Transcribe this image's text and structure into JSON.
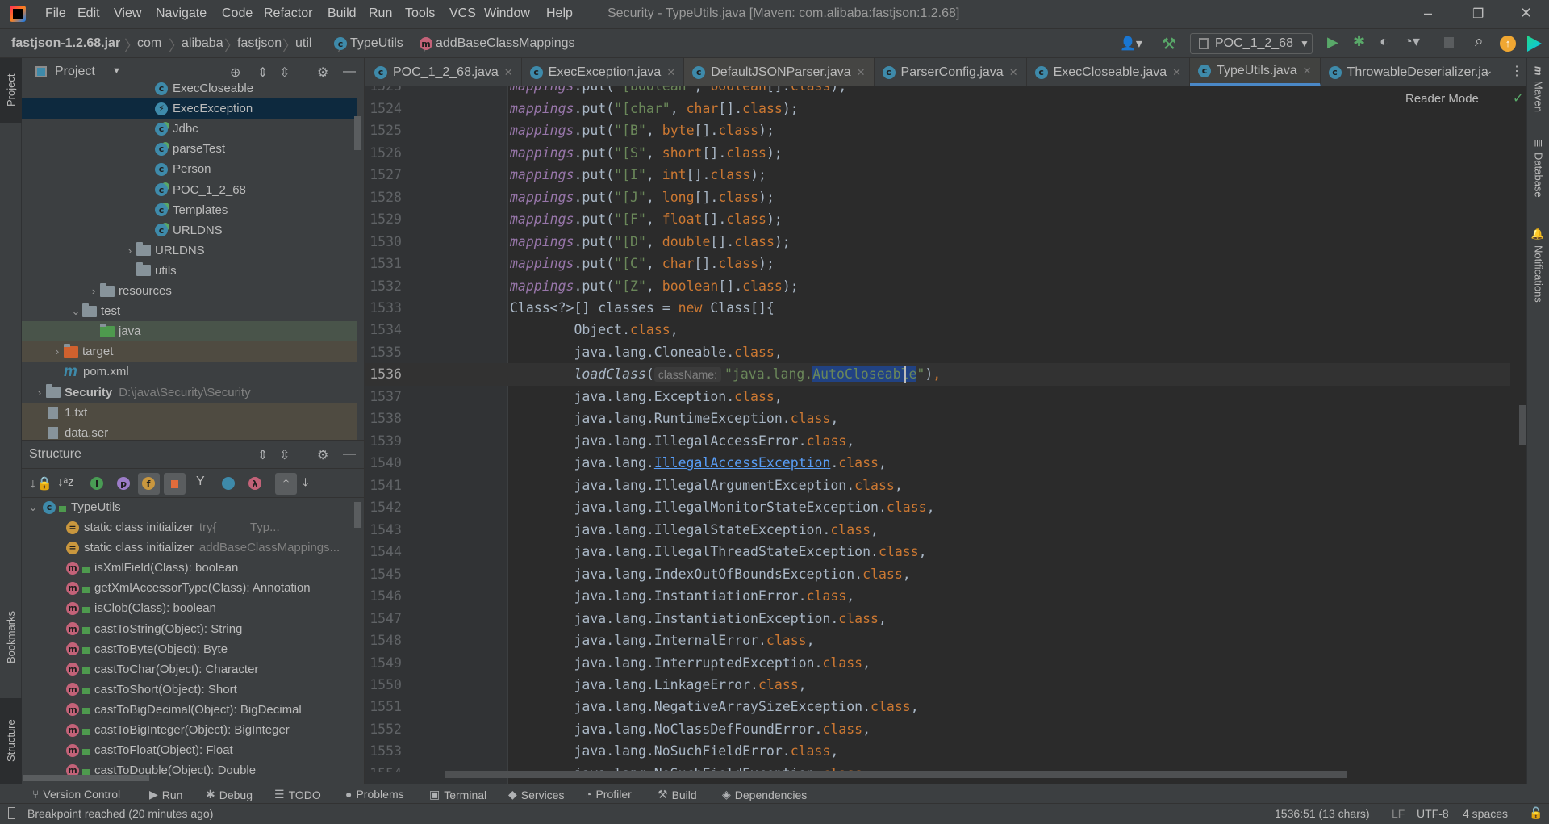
{
  "window": {
    "title": "Security - TypeUtils.java [Maven: com.alibaba:fastjson:1.2.68]",
    "menu": [
      "File",
      "Edit",
      "View",
      "Navigate",
      "Code",
      "Refactor",
      "Build",
      "Run",
      "Tools",
      "VCS",
      "Window",
      "Help"
    ]
  },
  "breadcrumb": [
    "fastjson-1.2.68.jar",
    "com",
    "alibaba",
    "fastjson",
    "util",
    "TypeUtils",
    "addBaseClassMappings"
  ],
  "run_config": "POC_1_2_68",
  "left_strip": [
    "Project",
    "Bookmarks",
    "Structure"
  ],
  "right_strip": [
    "Maven",
    "Database",
    "Notifications"
  ],
  "project": {
    "title": "Project",
    "items": [
      {
        "label": "ExecCloseable",
        "depth": 7,
        "icon": "class-icon"
      },
      {
        "label": "ExecException",
        "depth": 7,
        "icon": "exception-class-icon",
        "selected": true
      },
      {
        "label": "Jdbc",
        "depth": 7,
        "icon": "runnable-class-icon"
      },
      {
        "label": "parseTest",
        "depth": 7,
        "icon": "runnable-class-icon"
      },
      {
        "label": "Person",
        "depth": 7,
        "icon": "class-icon"
      },
      {
        "label": "POC_1_2_68",
        "depth": 7,
        "icon": "runnable-class-icon"
      },
      {
        "label": "Templates",
        "depth": 7,
        "icon": "runnable-class-icon"
      },
      {
        "label": "URLDNS",
        "depth": 7,
        "icon": "runnable-class-icon"
      },
      {
        "label": "URLDNS",
        "depth": 6,
        "icon": "package-icon",
        "chevron": "right"
      },
      {
        "label": "utils",
        "depth": 6,
        "icon": "package-icon"
      },
      {
        "label": "resources",
        "depth": 4,
        "icon": "resources-folder-icon",
        "chevron": "right"
      },
      {
        "label": "test",
        "depth": 3,
        "icon": "folder-icon",
        "chevron": "down"
      },
      {
        "label": "java",
        "depth": 4,
        "icon": "test-folder-icon",
        "highlight": "#49544A"
      },
      {
        "label": "target",
        "depth": 2,
        "icon": "excluded-folder-icon",
        "chevron": "right",
        "highlight": "#4F4B41"
      },
      {
        "label": "pom.xml",
        "depth": 2,
        "icon": "maven-icon"
      },
      {
        "label": "Security",
        "depth": 1,
        "icon": "module-icon",
        "chevron": "right",
        "bold": true,
        "extra": "D:\\java\\Security\\Security"
      },
      {
        "label": "1.txt",
        "depth": 1,
        "icon": "text-file-icon",
        "highlight": "#4F4B41"
      },
      {
        "label": "data.ser",
        "depth": 1,
        "icon": "file-icon",
        "highlight": "#4F4B41"
      }
    ]
  },
  "structure": {
    "title": "Structure",
    "root": "TypeUtils",
    "items": [
      {
        "label": "static class initializer",
        "extra": "try{          Typ...",
        "kind": "static"
      },
      {
        "label": "static class initializer",
        "extra": "addBaseClassMappings...",
        "kind": "static"
      },
      {
        "label": "isXmlField(Class): boolean",
        "kind": "method"
      },
      {
        "label": "getXmlAccessorType(Class): Annotation",
        "kind": "method"
      },
      {
        "label": "isClob(Class): boolean",
        "kind": "method"
      },
      {
        "label": "castToString(Object): String",
        "kind": "method"
      },
      {
        "label": "castToByte(Object): Byte",
        "kind": "method"
      },
      {
        "label": "castToChar(Object): Character",
        "kind": "method"
      },
      {
        "label": "castToShort(Object): Short",
        "kind": "method"
      },
      {
        "label": "castToBigDecimal(Object): BigDecimal",
        "kind": "method"
      },
      {
        "label": "castToBigInteger(Object): BigInteger",
        "kind": "method"
      },
      {
        "label": "castToFloat(Object): Float",
        "kind": "method"
      },
      {
        "label": "castToDouble(Object): Double",
        "kind": "method"
      }
    ]
  },
  "tabs": [
    {
      "label": "POC_1_2_68.java",
      "runnable": true
    },
    {
      "label": "ExecException.java"
    },
    {
      "label": "DefaultJSONParser.java"
    },
    {
      "label": "ParserConfig.java"
    },
    {
      "label": "ExecCloseable.java"
    },
    {
      "label": "TypeUtils.java",
      "active": true
    },
    {
      "label": "ThrowableDeserializer.ja",
      "noclose": true
    }
  ],
  "editor": {
    "reader_mode": "Reader Mode",
    "current_line": 1536,
    "first_line": 1523,
    "lines": [
      [
        [
          "f",
          "mappings"
        ],
        [
          "p",
          ".put("
        ],
        [
          "s",
          "\"[boolean\""
        ],
        [
          "p",
          ", "
        ],
        [
          "k",
          "boolean"
        ],
        [
          "p",
          "[]."
        ],
        [
          "k",
          "class"
        ],
        [
          "p",
          ");"
        ]
      ],
      [
        [
          "f",
          "mappings"
        ],
        [
          "p",
          ".put("
        ],
        [
          "s",
          "\"[char\""
        ],
        [
          "p",
          ", "
        ],
        [
          "k",
          "char"
        ],
        [
          "p",
          "[]."
        ],
        [
          "k",
          "class"
        ],
        [
          "p",
          ");"
        ]
      ],
      [
        [
          "f",
          "mappings"
        ],
        [
          "p",
          ".put("
        ],
        [
          "s",
          "\"[B\""
        ],
        [
          "p",
          ", "
        ],
        [
          "k",
          "byte"
        ],
        [
          "p",
          "[]."
        ],
        [
          "k",
          "class"
        ],
        [
          "p",
          ");"
        ]
      ],
      [
        [
          "f",
          "mappings"
        ],
        [
          "p",
          ".put("
        ],
        [
          "s",
          "\"[S\""
        ],
        [
          "p",
          ", "
        ],
        [
          "k",
          "short"
        ],
        [
          "p",
          "[]."
        ],
        [
          "k",
          "class"
        ],
        [
          "p",
          ");"
        ]
      ],
      [
        [
          "f",
          "mappings"
        ],
        [
          "p",
          ".put("
        ],
        [
          "s",
          "\"[I\""
        ],
        [
          "p",
          ", "
        ],
        [
          "k",
          "int"
        ],
        [
          "p",
          "[]."
        ],
        [
          "k",
          "class"
        ],
        [
          "p",
          ");"
        ]
      ],
      [
        [
          "f",
          "mappings"
        ],
        [
          "p",
          ".put("
        ],
        [
          "s",
          "\"[J\""
        ],
        [
          "p",
          ", "
        ],
        [
          "k",
          "long"
        ],
        [
          "p",
          "[]."
        ],
        [
          "k",
          "class"
        ],
        [
          "p",
          ");"
        ]
      ],
      [
        [
          "f",
          "mappings"
        ],
        [
          "p",
          ".put("
        ],
        [
          "s",
          "\"[F\""
        ],
        [
          "p",
          ", "
        ],
        [
          "k",
          "float"
        ],
        [
          "p",
          "[]."
        ],
        [
          "k",
          "class"
        ],
        [
          "p",
          ");"
        ]
      ],
      [
        [
          "f",
          "mappings"
        ],
        [
          "p",
          ".put("
        ],
        [
          "s",
          "\"[D\""
        ],
        [
          "p",
          ", "
        ],
        [
          "k",
          "double"
        ],
        [
          "p",
          "[]."
        ],
        [
          "k",
          "class"
        ],
        [
          "p",
          ");"
        ]
      ],
      [
        [
          "f",
          "mappings"
        ],
        [
          "p",
          ".put("
        ],
        [
          "s",
          "\"[C\""
        ],
        [
          "p",
          ", "
        ],
        [
          "k",
          "char"
        ],
        [
          "p",
          "[]."
        ],
        [
          "k",
          "class"
        ],
        [
          "p",
          ");"
        ]
      ],
      [
        [
          "f",
          "mappings"
        ],
        [
          "p",
          ".put("
        ],
        [
          "s",
          "\"[Z\""
        ],
        [
          "p",
          ", "
        ],
        [
          "k",
          "boolean"
        ],
        [
          "p",
          "[]."
        ],
        [
          "k",
          "class"
        ],
        [
          "p",
          ");"
        ]
      ],
      [
        [
          "p",
          "Class<?>[] classes = "
        ],
        [
          "k",
          "new "
        ],
        [
          "p",
          "Class[]{"
        ]
      ],
      [
        [
          "p",
          "        Object."
        ],
        [
          "k",
          "class"
        ],
        [
          "p",
          ","
        ]
      ],
      [
        [
          "p",
          "        java.lang.Cloneable."
        ],
        [
          "k",
          "class"
        ],
        [
          "p",
          ","
        ]
      ],
      [
        [
          "p",
          "        "
        ],
        [
          "m",
          "loadClass"
        ],
        [
          "p",
          "("
        ],
        [
          "h",
          "className:"
        ],
        [
          "s",
          "\"java.lang."
        ],
        [
          "sel",
          "AutoCloseable"
        ],
        [
          "s",
          "\""
        ],
        [
          "p",
          ")"
        ],
        [
          "k",
          ","
        ]
      ],
      [
        [
          "p",
          "        java.lang.Exception."
        ],
        [
          "k",
          "class"
        ],
        [
          "p",
          ","
        ]
      ],
      [
        [
          "p",
          "        java.lang.RuntimeException."
        ],
        [
          "k",
          "class"
        ],
        [
          "p",
          ","
        ]
      ],
      [
        [
          "p",
          "        java.lang.IllegalAccessError."
        ],
        [
          "k",
          "class"
        ],
        [
          "p",
          ","
        ]
      ],
      [
        [
          "p",
          "        java.lang."
        ],
        [
          "l",
          "IllegalAccessException"
        ],
        [
          "p",
          "."
        ],
        [
          "k",
          "class"
        ],
        [
          "p",
          ","
        ]
      ],
      [
        [
          "p",
          "        java.lang.IllegalArgumentException."
        ],
        [
          "k",
          "class"
        ],
        [
          "p",
          ","
        ]
      ],
      [
        [
          "p",
          "        java.lang.IllegalMonitorStateException."
        ],
        [
          "k",
          "class"
        ],
        [
          "p",
          ","
        ]
      ],
      [
        [
          "p",
          "        java.lang.IllegalStateException."
        ],
        [
          "k",
          "class"
        ],
        [
          "p",
          ","
        ]
      ],
      [
        [
          "p",
          "        java.lang.IllegalThreadStateException."
        ],
        [
          "k",
          "class"
        ],
        [
          "p",
          ","
        ]
      ],
      [
        [
          "p",
          "        java.lang.IndexOutOfBoundsException."
        ],
        [
          "k",
          "class"
        ],
        [
          "p",
          ","
        ]
      ],
      [
        [
          "p",
          "        java.lang.InstantiationError."
        ],
        [
          "k",
          "class"
        ],
        [
          "p",
          ","
        ]
      ],
      [
        [
          "p",
          "        java.lang.InstantiationException."
        ],
        [
          "k",
          "class"
        ],
        [
          "p",
          ","
        ]
      ],
      [
        [
          "p",
          "        java.lang.InternalError."
        ],
        [
          "k",
          "class"
        ],
        [
          "p",
          ","
        ]
      ],
      [
        [
          "p",
          "        java.lang.InterruptedException."
        ],
        [
          "k",
          "class"
        ],
        [
          "p",
          ","
        ]
      ],
      [
        [
          "p",
          "        java.lang.LinkageError."
        ],
        [
          "k",
          "class"
        ],
        [
          "p",
          ","
        ]
      ],
      [
        [
          "p",
          "        java.lang.NegativeArraySizeException."
        ],
        [
          "k",
          "class"
        ],
        [
          "p",
          ","
        ]
      ],
      [
        [
          "p",
          "        java.lang.NoClassDefFoundError."
        ],
        [
          "k",
          "class"
        ],
        [
          "p",
          ","
        ]
      ],
      [
        [
          "p",
          "        java.lang.NoSuchFieldError."
        ],
        [
          "k",
          "class"
        ],
        [
          "p",
          ","
        ]
      ],
      [
        [
          "p",
          "        java.lang.NoSuchFieldException."
        ],
        [
          "k",
          "class"
        ],
        [
          "p",
          ","
        ]
      ]
    ]
  },
  "bottom_tools": [
    "Version Control",
    "Run",
    "Debug",
    "TODO",
    "Problems",
    "Terminal",
    "Services",
    "Profiler",
    "Build",
    "Dependencies"
  ],
  "status": {
    "message": "Breakpoint reached (20 minutes ago)",
    "position": "1536:51 (13 chars)",
    "line_sep": "LF",
    "encoding": "UTF-8",
    "indent": "4 spaces"
  },
  "colors": {
    "accent": "#4A88C7",
    "selection": "#214283",
    "keyword": "#CC7832",
    "string": "#6A8759",
    "field": "#9876AA"
  }
}
